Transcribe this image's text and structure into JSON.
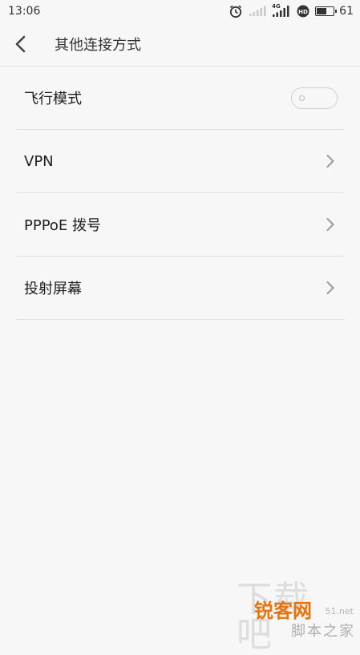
{
  "status_bar": {
    "time": "13:06",
    "network_label": "4G",
    "battery_level": "61",
    "battery_fraction": 0.61,
    "icons": [
      "alarm-icon",
      "signal-weak-icon",
      "signal-4g-icon",
      "hd-icon",
      "battery-icon"
    ]
  },
  "header": {
    "title": "其他连接方式",
    "back_icon": "chevron-left-icon"
  },
  "settings": {
    "airplane_mode": {
      "label": "飞行模式",
      "enabled": false
    },
    "items": [
      {
        "label": "VPN"
      },
      {
        "label": "PPPoE 拨号"
      },
      {
        "label": "投射屏幕"
      }
    ]
  },
  "watermark": {
    "ghost": "下载吧",
    "brand": "锐客网",
    "url": "51.net",
    "sub": "脚本之家"
  },
  "colors": {
    "background": "#f7f7f7",
    "divider": "#e2e2e2",
    "text": "#1e1e1e",
    "chevron": "#9a9a9a",
    "watermark_brand": "#e8730c"
  }
}
